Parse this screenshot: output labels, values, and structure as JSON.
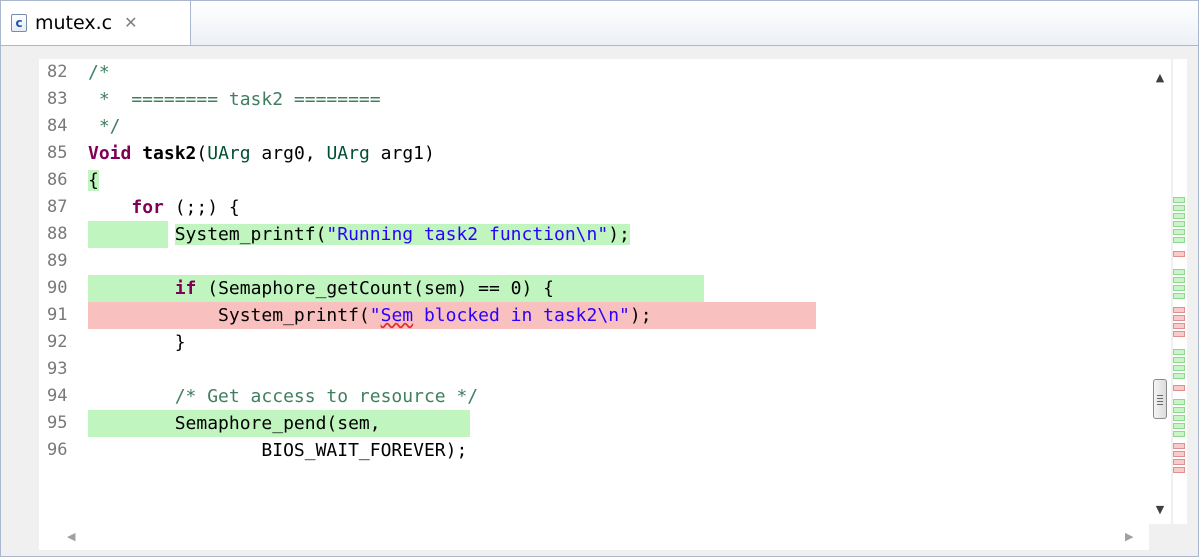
{
  "tab": {
    "title": "mutex.c",
    "icon": "c-source-file-icon",
    "close_glyph": "✕"
  },
  "lines": [
    {
      "number": "82",
      "highlight": "none"
    },
    {
      "number": "83",
      "highlight": "none"
    },
    {
      "number": "84",
      "highlight": "none"
    },
    {
      "number": "85",
      "highlight": "none"
    },
    {
      "number": "86",
      "highlight": "none"
    },
    {
      "number": "87",
      "highlight": "none"
    },
    {
      "number": "88",
      "highlight": "covered"
    },
    {
      "number": "89",
      "highlight": "none"
    },
    {
      "number": "90",
      "highlight": "covered"
    },
    {
      "number": "91",
      "highlight": "not-covered"
    },
    {
      "number": "92",
      "highlight": "none"
    },
    {
      "number": "93",
      "highlight": "none"
    },
    {
      "number": "94",
      "highlight": "none"
    },
    {
      "number": "95",
      "highlight": "covered"
    },
    {
      "number": "96",
      "highlight": "none"
    }
  ],
  "code": {
    "l82": "/*",
    "l83": " *  ======== task2 ========",
    "l84": " */",
    "l85_type": "Void",
    "l85_name": "task2",
    "l85_p1": "(",
    "l85_t1": "UArg",
    "l85_p2": " arg0, ",
    "l85_t2": "UArg",
    "l85_p3": " arg1)",
    "l86": "{",
    "l87_indent": "    ",
    "l87_kw": "for",
    "l87_rest": " (;;) {",
    "l88_pre": "        System_printf(",
    "l88_str": "\"Running task2 function\\n\"",
    "l88_post": ");",
    "l90_indent": "        ",
    "l90_kw": "if",
    "l90_rest": " (Semaphore_getCount(sem) == 0) {",
    "l91_pre": "            System_printf(",
    "l91_q": "\"",
    "l91_sq": "Sem",
    "l91_str": " blocked in task2\\n\"",
    "l91_post": ");",
    "l92": "        }",
    "l94": "        /* Get access to resource */",
    "l95": "        Semaphore_pend(sem,",
    "l96": "                BIOS_WAIT_FOREVER);"
  },
  "colors": {
    "covered": "#c0f5c0",
    "not_covered": "#f9c0c0",
    "keyword": "#7f0055",
    "comment": "#3f7f5f",
    "string": "#2a00ff"
  }
}
